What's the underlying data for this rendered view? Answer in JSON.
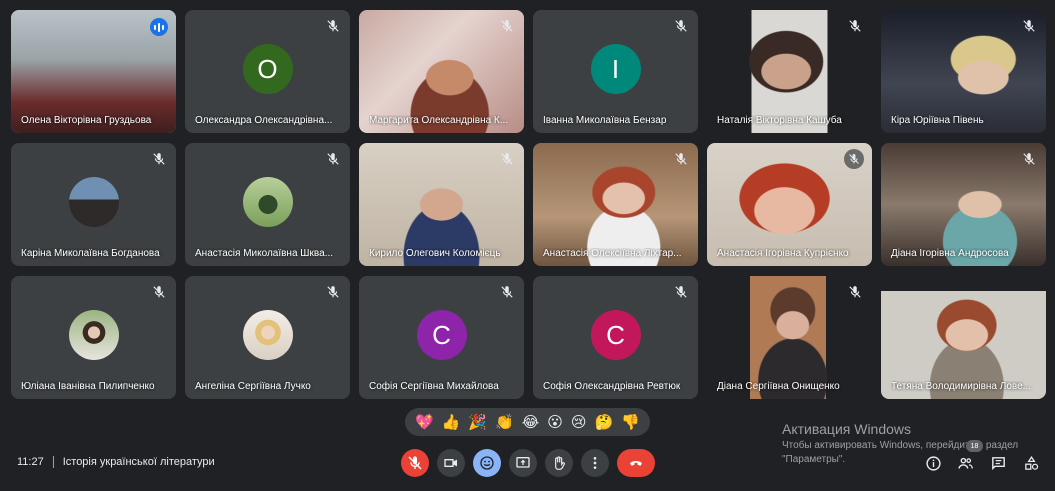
{
  "participants": [
    {
      "name": "Олена Вікторівна Груздьова",
      "speaking": true
    },
    {
      "name": "Олександра Олександрівна...",
      "letter": "О",
      "color": "#33691e"
    },
    {
      "name": "Маргарита Олександрівна К..."
    },
    {
      "name": "Іванна Миколаївна Бензар",
      "letter": "І",
      "color": "#00897b"
    },
    {
      "name": "Наталія Вікторівна Кашуба"
    },
    {
      "name": "Кіра Юріївна Півень"
    },
    {
      "name": "Каріна Миколаївна Богданова"
    },
    {
      "name": "Анастасія Миколаївна Шквa..."
    },
    {
      "name": "Кирило Олегович Коломієць"
    },
    {
      "name": "Анастасія Олексіївна Ліхтар..."
    },
    {
      "name": "Анастасія Ігорівна Купрієнко"
    },
    {
      "name": "Діана Ігорівна Андросова"
    },
    {
      "name": "Юліана Іванівна Пилипченко"
    },
    {
      "name": "Ангеліна Сергіївна Лучко"
    },
    {
      "name": "Софія Сергіївна Михайлова",
      "letter": "С",
      "color": "#8e24aa"
    },
    {
      "name": "Софія Олександрівна Ревтюк",
      "letter": "С",
      "color": "#c2185b"
    },
    {
      "name": "Діана Сергіївна Онищенко"
    },
    {
      "name": "Тетяна Володимирівна Лове..."
    }
  ],
  "reactions": [
    "💖",
    "👍",
    "🎉",
    "👏",
    "😂",
    "😮",
    "😢",
    "🤔",
    "👎"
  ],
  "meeting": {
    "time": "11:27",
    "title": "Історія української літератури"
  },
  "watermark": {
    "title": "Активация Windows",
    "text": "Чтобы активировать Windows, перейдите в раздел \"Параметры\"."
  },
  "people_count": "18",
  "colors": {
    "background": "#202124",
    "tile": "#3c4043",
    "accent": "#8ab4f8",
    "danger": "#ea4335"
  }
}
